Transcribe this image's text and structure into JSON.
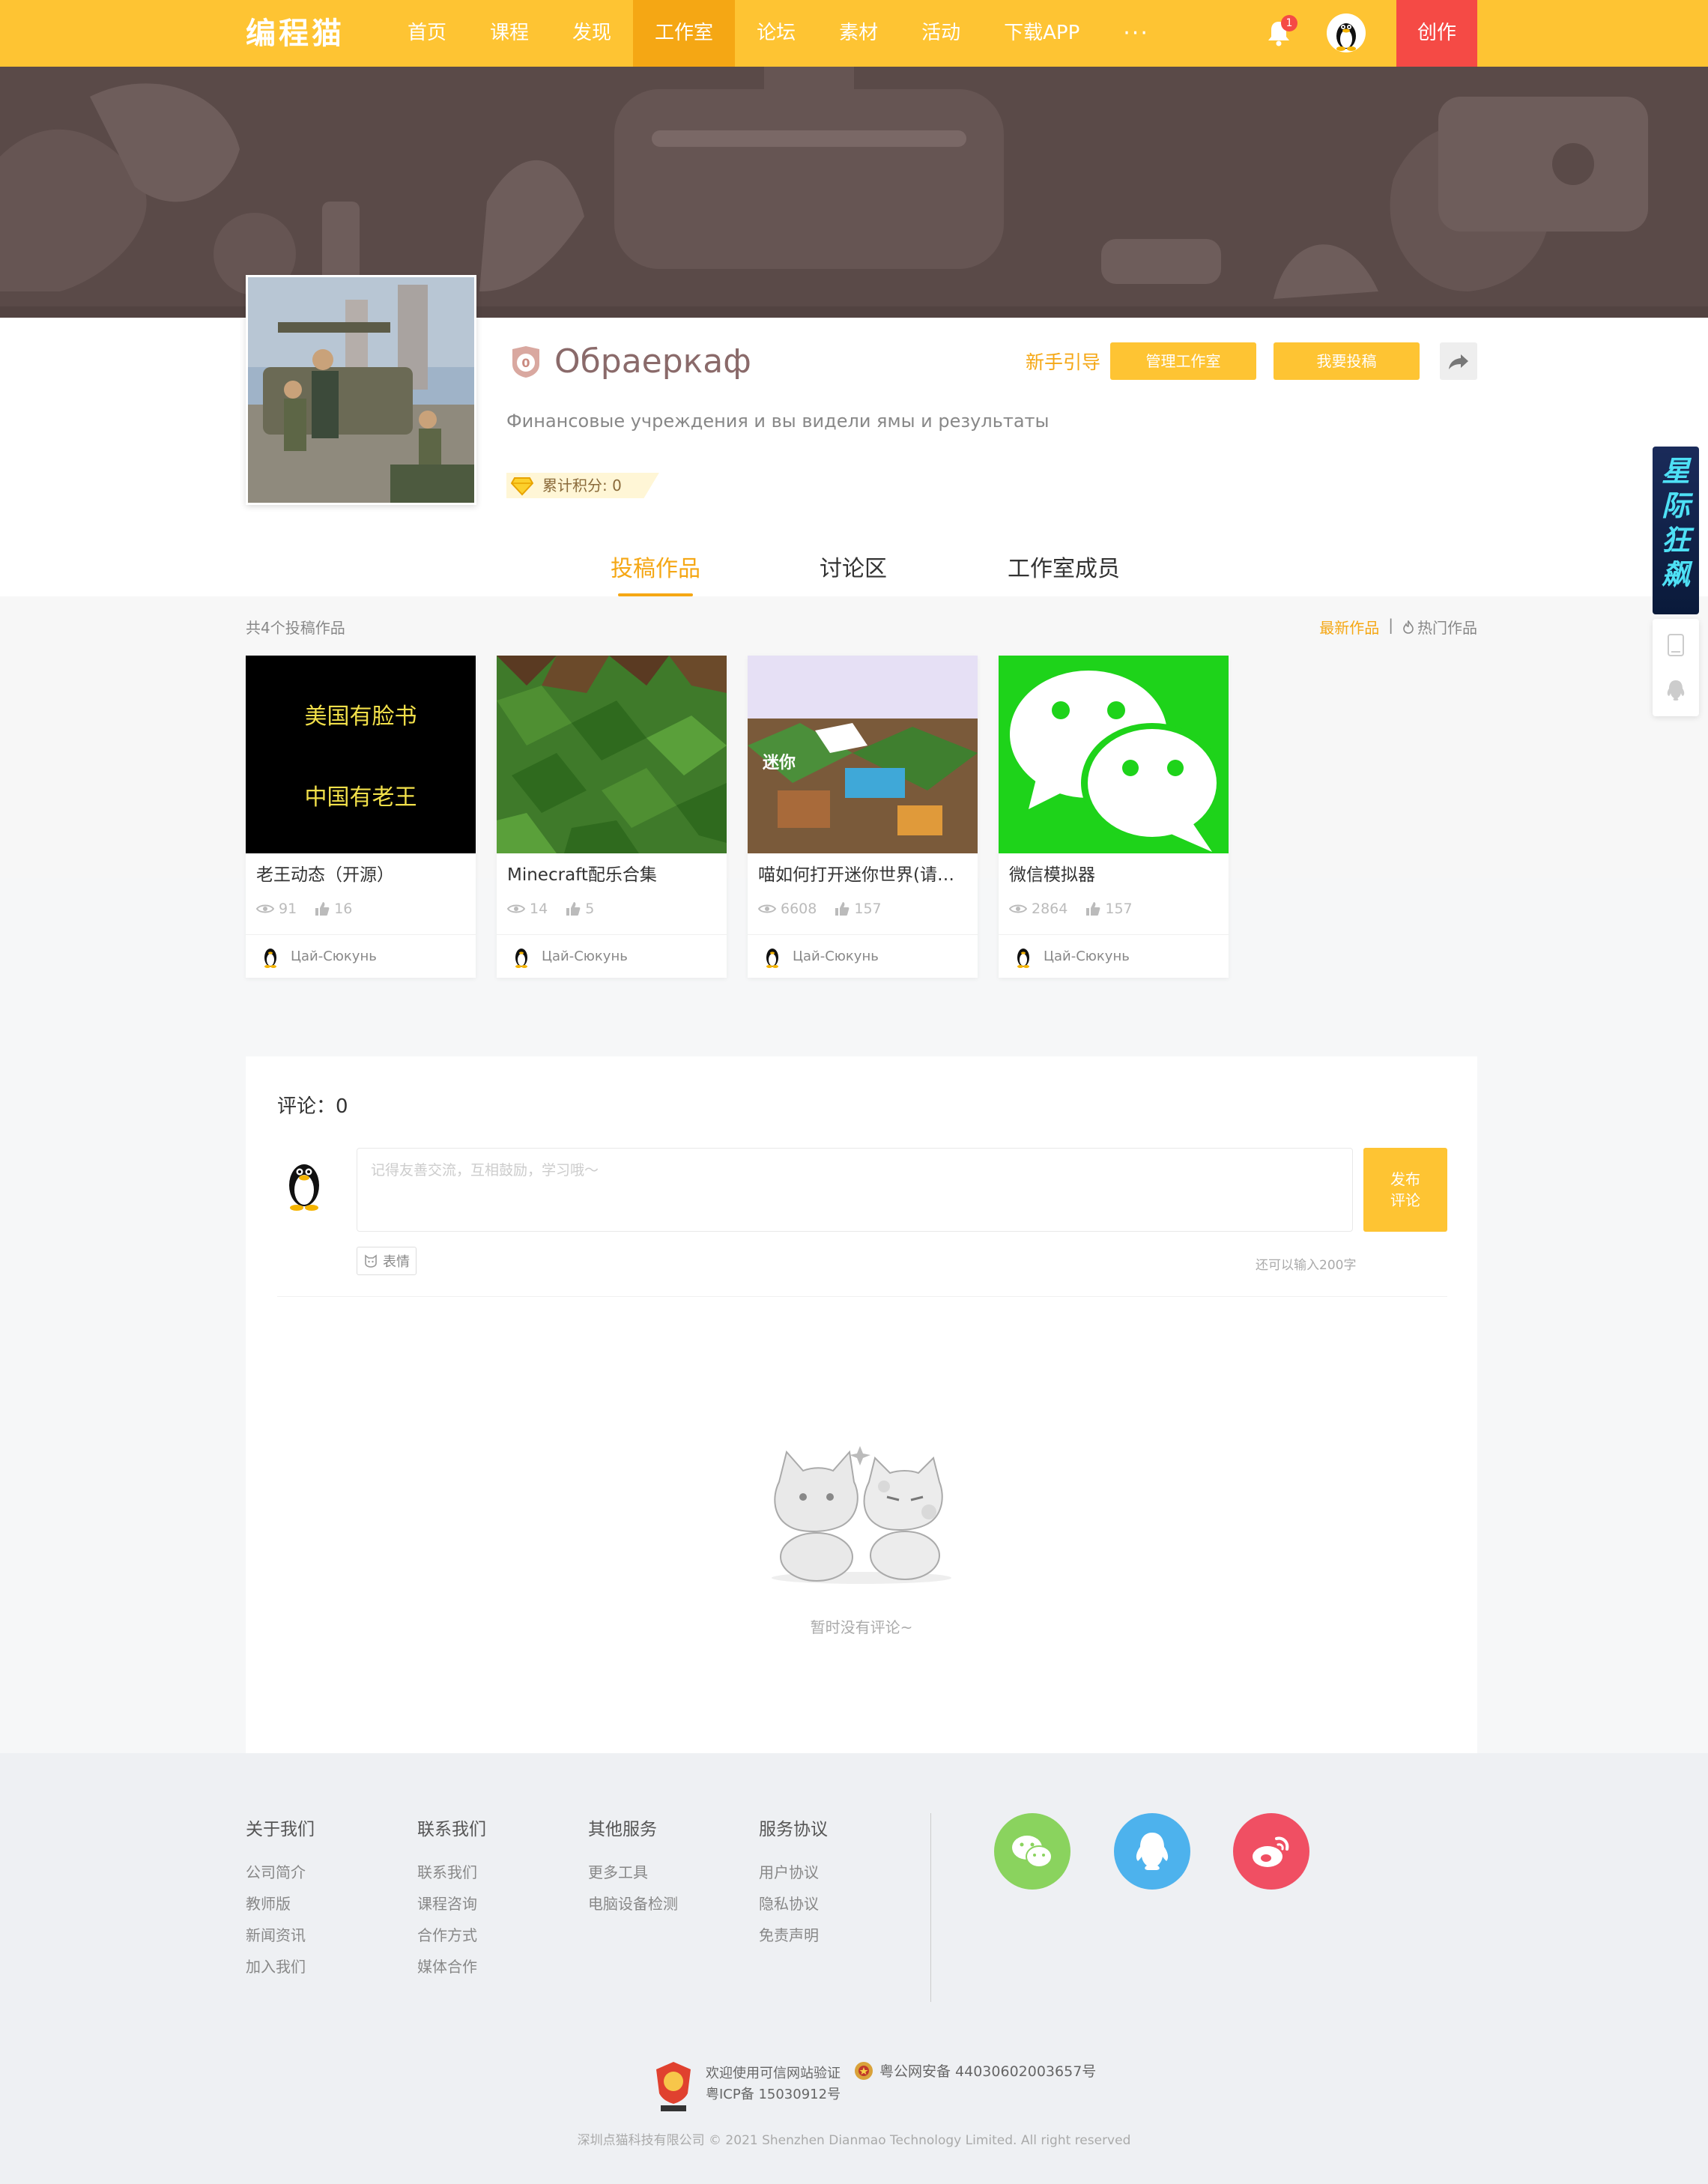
{
  "nav": {
    "logo": "编程猫",
    "items": [
      "首页",
      "课程",
      "发现",
      "工作室",
      "论坛",
      "素材",
      "活动",
      "下载APP"
    ],
    "active_index": 3,
    "more": "···",
    "bell_count": "1",
    "create_label": "创作"
  },
  "studio": {
    "level": "0",
    "name": "Обраеркаф",
    "description": "Финансовые учреждения и вы видели ямы и результаты",
    "points_label": "累计积分: 0",
    "guide_label": "新手引导",
    "manage_label": "管理工作室",
    "submit_label": "我要投稿"
  },
  "tabs": [
    "投稿作品",
    "讨论区",
    "工作室成员"
  ],
  "works": {
    "count_label": "共4个投稿作品",
    "sort_latest": "最新作品",
    "sort_sep": "|",
    "sort_hot": "热门作品",
    "items": [
      {
        "title": "老王动态（开源）",
        "views": "91",
        "likes": "16",
        "author": "Цай-Сюкунь",
        "cover_line1": "美国有脸书",
        "cover_line2": "中国有老王"
      },
      {
        "title": "Minecraft配乐合集",
        "views": "14",
        "likes": "5",
        "author": "Цай-Сюкунь"
      },
      {
        "title": "喵如何打开迷你世界(请再...",
        "views": "6608",
        "likes": "157",
        "author": "Цай-Сюкунь"
      },
      {
        "title": "微信模拟器",
        "views": "2864",
        "likes": "157",
        "author": "Цай-Сюкунь"
      }
    ]
  },
  "comments": {
    "title": "评论：0",
    "placeholder": "记得友善交流，互相鼓励，学习哦～",
    "post_label": "发布评论",
    "emoji_label": "表情",
    "remaining": "还可以输入200字",
    "empty": "暂时没有评论~"
  },
  "footer": {
    "cols": [
      {
        "head": "关于我们",
        "links": [
          "公司简介",
          "教师版",
          "新闻资讯",
          "加入我们"
        ]
      },
      {
        "head": "联系我们",
        "links": [
          "联系我们",
          "课程咨询",
          "合作方式",
          "媒体合作"
        ]
      },
      {
        "head": "其他服务",
        "links": [
          "更多工具",
          "电脑设备检测"
        ]
      },
      {
        "head": "服务协议",
        "links": [
          "用户协议",
          "隐私协议",
          "免责声明"
        ]
      }
    ],
    "trust_line1": "欢迎使用可信网站验证",
    "trust_line2": "粤ICP备 15030912号",
    "police": "粤公网安备 44030602003657号",
    "copyright": "深圳点猫科技有限公司   © 2021 Shenzhen Dianmao Technology Limited. All right reserved"
  },
  "ad": {
    "text": "星际狂飙"
  },
  "colors": {
    "primary": "#fec433",
    "accent": "#f5a714",
    "create": "#f54a45"
  }
}
